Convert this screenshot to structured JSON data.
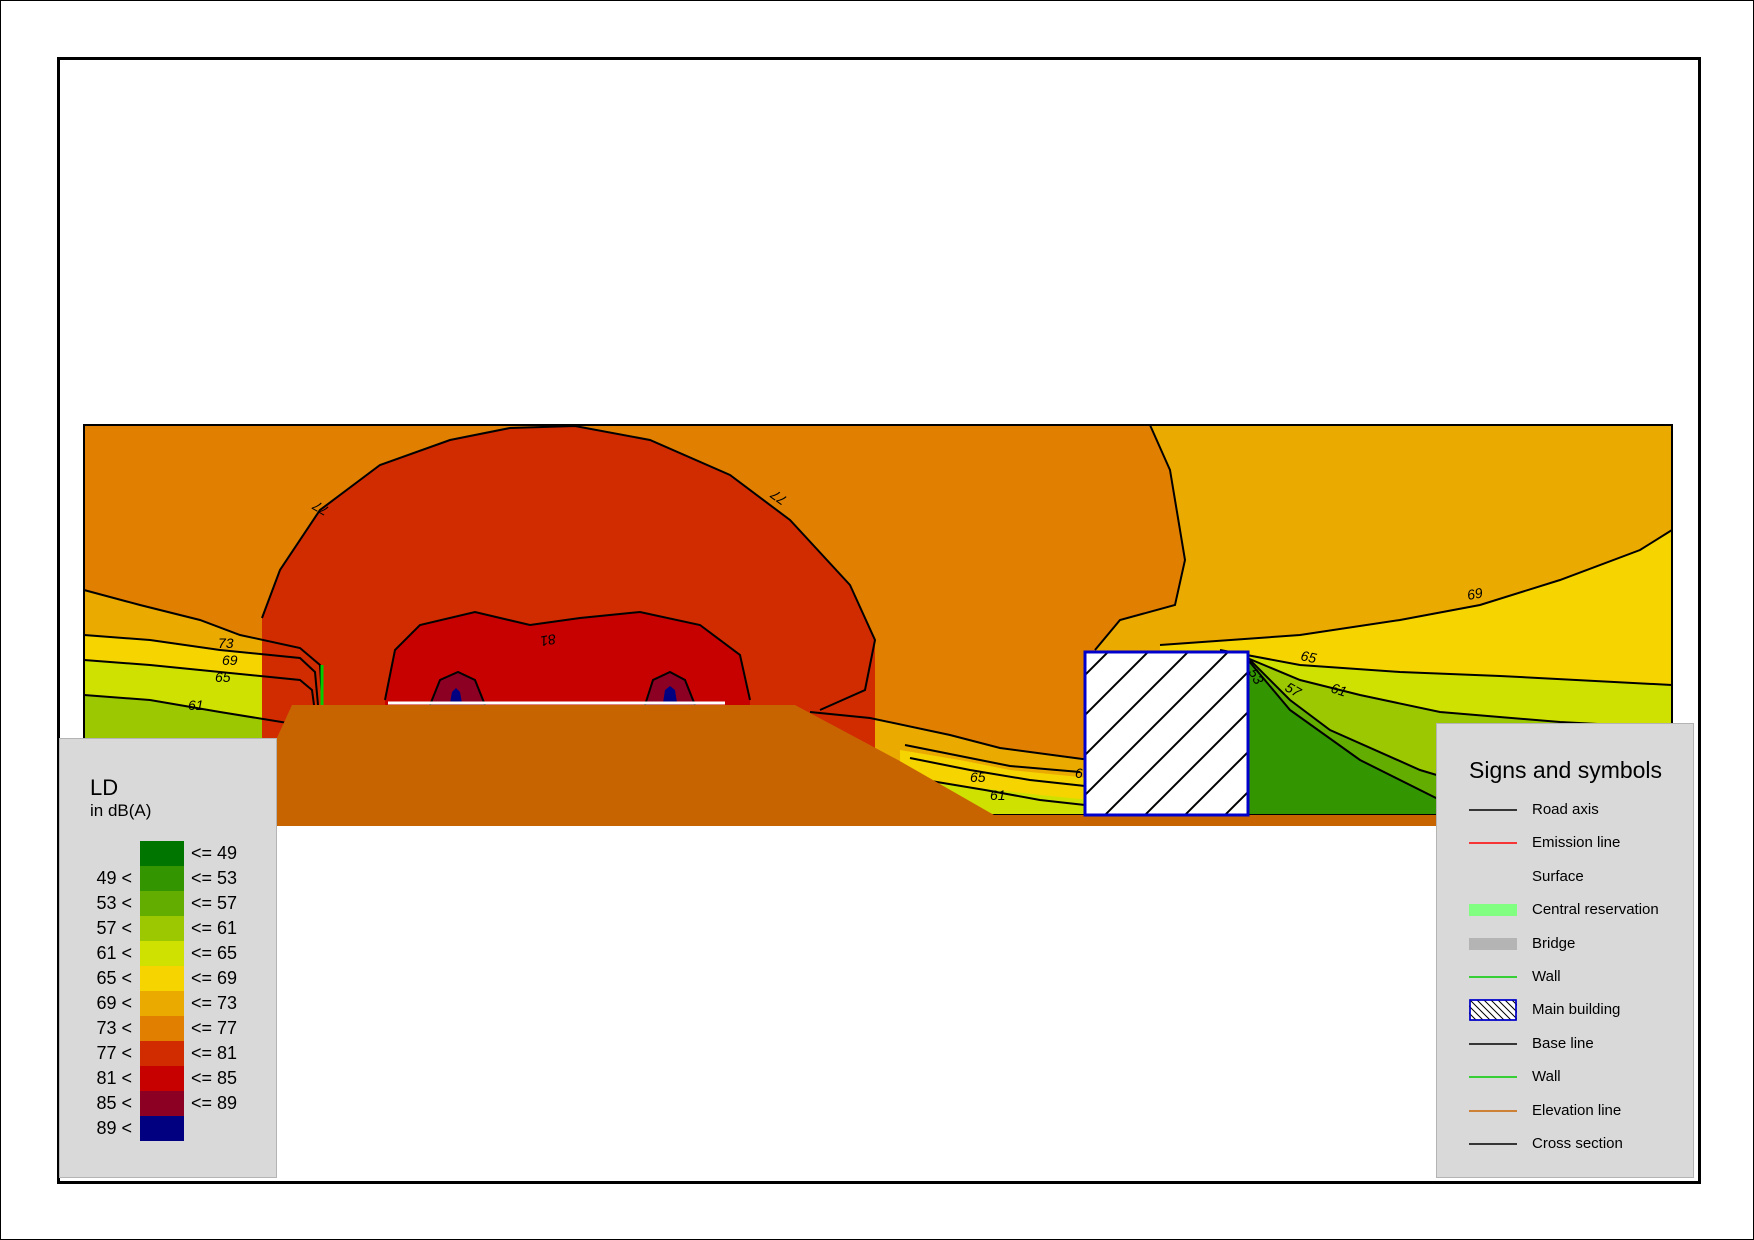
{
  "map": {
    "contour_labels": [
      {
        "text": "77"
      },
      {
        "text": "77"
      },
      {
        "text": "81"
      },
      {
        "text": "73"
      },
      {
        "text": "69"
      },
      {
        "text": "65"
      },
      {
        "text": "61"
      },
      {
        "text": "65"
      },
      {
        "text": "61"
      },
      {
        "text": "6"
      },
      {
        "text": "69"
      },
      {
        "text": "65"
      },
      {
        "text": "53"
      },
      {
        "text": "57"
      },
      {
        "text": "61"
      }
    ],
    "colors": {
      "band_65_69": "#f5d400",
      "band_69_73": "#ebaa00",
      "band_73_77": "#e07f00",
      "band_77_81": "#d12b00",
      "band_81_85": "#c70000",
      "band_85_89": "#8c0024",
      "band_89_plus": "#000080",
      "band_61_65": "#cfe100",
      "band_57_61": "#9bc800",
      "band_53_57": "#63ad00",
      "band_49_53": "#339600",
      "ground": "#c86400",
      "building_outline": "#0000cc"
    }
  },
  "ld_legend": {
    "title": "LD",
    "unit": "in dB(A)",
    "rows": [
      {
        "lo": "",
        "hi": "<= 49",
        "color": "#007500"
      },
      {
        "lo": "49 <",
        "hi": "<= 53",
        "color": "#339600"
      },
      {
        "lo": "53 <",
        "hi": "<= 57",
        "color": "#63ad00"
      },
      {
        "lo": "57 <",
        "hi": "<= 61",
        "color": "#9bc800"
      },
      {
        "lo": "61 <",
        "hi": "<= 65",
        "color": "#cfe100"
      },
      {
        "lo": "65 <",
        "hi": "<= 69",
        "color": "#f5d400"
      },
      {
        "lo": "69 <",
        "hi": "<= 73",
        "color": "#ebaa00"
      },
      {
        "lo": "73 <",
        "hi": "<= 77",
        "color": "#e07f00"
      },
      {
        "lo": "77 <",
        "hi": "<= 81",
        "color": "#d12b00"
      },
      {
        "lo": "81 <",
        "hi": "<= 85",
        "color": "#c70000"
      },
      {
        "lo": "85 <",
        "hi": "<= 89",
        "color": "#8c0024"
      },
      {
        "lo": "89 <",
        "hi": "",
        "color": "#000080"
      }
    ]
  },
  "symbols_legend": {
    "title": "Signs and symbols",
    "items": [
      {
        "label": "Road axis",
        "kind": "line",
        "color": "#000000"
      },
      {
        "label": "Emission line",
        "kind": "line",
        "color": "#ff0000"
      },
      {
        "label": "Surface",
        "kind": "none",
        "color": ""
      },
      {
        "label": "Central reservation",
        "kind": "fill",
        "color": "#80ff80"
      },
      {
        "label": "Bridge",
        "kind": "fill",
        "color": "#b4b4b4"
      },
      {
        "label": "Wall",
        "kind": "line",
        "color": "#00cc00"
      },
      {
        "label": "Main building",
        "kind": "hatch",
        "color": "#0000cc"
      },
      {
        "label": "Base line",
        "kind": "line",
        "color": "#000000"
      },
      {
        "label": "Wall",
        "kind": "line",
        "color": "#00cc00"
      },
      {
        "label": "Elevation line",
        "kind": "line",
        "color": "#c86400"
      },
      {
        "label": "Cross section",
        "kind": "line",
        "color": "#000000"
      }
    ]
  }
}
